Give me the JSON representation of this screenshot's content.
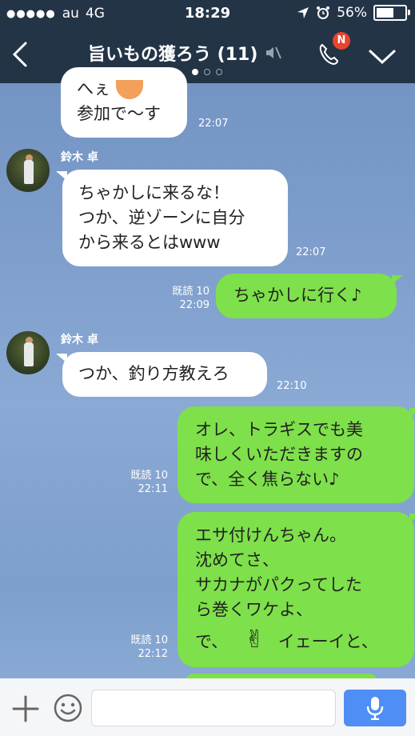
{
  "status": {
    "carrier": "au",
    "network": "4G",
    "time": "18:29",
    "battery": "56%"
  },
  "header": {
    "title": "旨いもの獲ろう (11)",
    "notification_badge": "N"
  },
  "messages": {
    "m1": {
      "line1": "へぇ",
      "line2": "参加で〜す",
      "time": "22:07"
    },
    "m2": {
      "sender": "鈴木 卓",
      "line1": "ちゃかしに来るな！",
      "line2": "つか、逆ゾーンに自分",
      "line3": "から来るとはwww",
      "time": "22:07"
    },
    "m3": {
      "read": "既読 10",
      "time": "22:09",
      "text": "ちゃかしに行く♪"
    },
    "m4": {
      "sender": "鈴木 卓",
      "text": "つか、釣り方教えろ",
      "time": "22:10"
    },
    "m5": {
      "read": "既読 10",
      "time": "22:11",
      "line1": "オレ、トラギスでも美",
      "line2": "味しくいただきますの",
      "line3": "で、全く焦らない♪"
    },
    "m6": {
      "read": "既読 10",
      "time": "22:12",
      "line1": "エサ付けんちゃん。",
      "line2": "沈めてさ、",
      "line3": "サカナがパクってした",
      "line4": "ら巻くワケよ、",
      "line5a": "で、",
      "line5_emoji": "✌",
      "line5b": "イェーイと、"
    }
  },
  "footer": {
    "input_value": ""
  },
  "colors": {
    "header_bg": "#243447",
    "bubble_out": "#7ee04a",
    "bubble_in": "#ffffff",
    "mic_button": "#4f8ef5",
    "badge": "#e8452c"
  }
}
